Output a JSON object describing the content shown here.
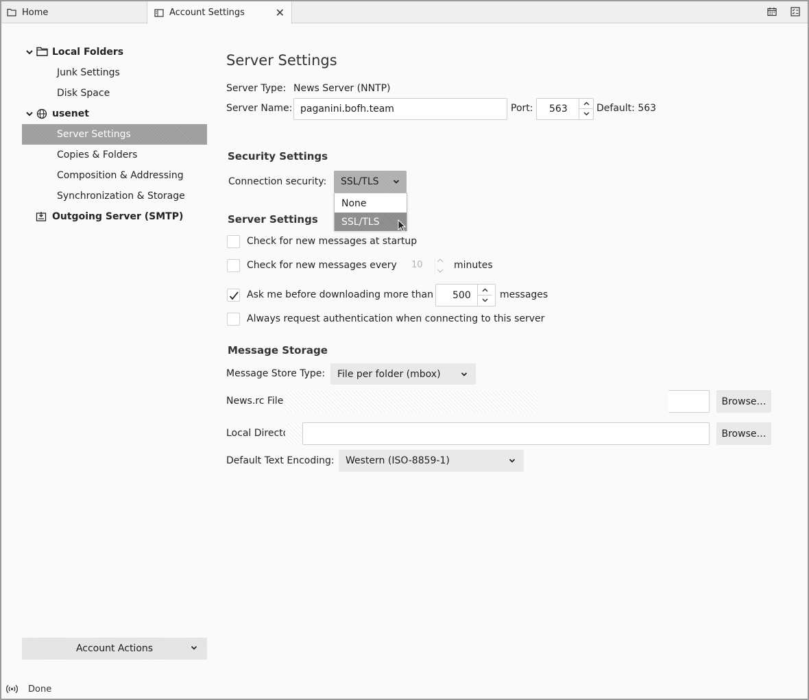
{
  "tabs": [
    {
      "label": "Home",
      "icon": "folder-icon"
    },
    {
      "label": "Account Settings",
      "icon": "settings-tab-icon",
      "active": true
    }
  ],
  "toolbar_icons": [
    "calendar-icon",
    "tasks-icon"
  ],
  "sidebar": {
    "items": [
      {
        "label": "Local Folders",
        "icon": "folder-icon",
        "expanded": true
      },
      {
        "label": "Junk Settings"
      },
      {
        "label": "Disk Space"
      },
      {
        "label": "usenet",
        "icon": "globe-icon",
        "expanded": true
      },
      {
        "label": "Server Settings",
        "selected": true
      },
      {
        "label": "Copies & Folders"
      },
      {
        "label": "Composition & Addressing"
      },
      {
        "label": "Synchronization & Storage"
      },
      {
        "label": "Outgoing Server (SMTP)",
        "icon": "outgoing-server-icon"
      }
    ],
    "account_actions": "Account Actions"
  },
  "main": {
    "title": "Server Settings",
    "server_type_label": "Server Type:",
    "server_type_value": "News Server (NNTP)",
    "server_name_label": "Server Name:",
    "server_name_value": "paganini.bofh.team",
    "port_label": "Port:",
    "port_value": "563",
    "default_port": "Default: 563",
    "security": {
      "heading": "Security Settings",
      "connection_label": "Connection security:",
      "selected": "SSL/TLS",
      "options": [
        "None",
        "SSL/TLS"
      ]
    },
    "server_settings": {
      "heading": "Server Settings",
      "check_startup": {
        "label": "Check for new messages at startup",
        "checked": false
      },
      "check_every": {
        "label": "Check for new messages every",
        "value": "10",
        "unit": "minutes",
        "checked": false
      },
      "ask_before": {
        "label": "Ask me before downloading more than",
        "value": "500",
        "unit": "messages",
        "checked": true
      },
      "always_auth": {
        "label": "Always request authentication when connecting to this server",
        "checked": false
      }
    },
    "storage": {
      "heading": "Message Storage",
      "store_type_label": "Message Store Type:",
      "store_type_value": "File per folder (mbox)",
      "newsrc_label": "News.rc File",
      "local_dir_label": "Local Directo",
      "browse": "Browse…",
      "encoding_label": "Default Text Encoding:",
      "encoding_value": "Western (ISO-8859-1)"
    }
  },
  "status": {
    "text": "Done",
    "icon": "broadcast-icon"
  }
}
